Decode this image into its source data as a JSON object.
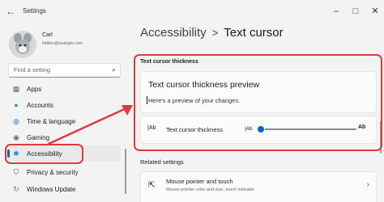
{
  "window": {
    "title": "Settings",
    "back_icon": "arrow-left-icon",
    "controls": {
      "minimize": "–",
      "maximize": "□",
      "close": "✕"
    }
  },
  "user": {
    "name": "Carl",
    "email": "hidden@example.com"
  },
  "search": {
    "placeholder": "Find a setting",
    "icon": "search-icon"
  },
  "nav": {
    "items": [
      {
        "label": "Apps",
        "icon": "apps-icon",
        "glyph": "▦",
        "color": "#5a6b85"
      },
      {
        "label": "Accounts",
        "icon": "accounts-icon",
        "glyph": "●",
        "color": "#2aa876"
      },
      {
        "label": "Time & language",
        "icon": "globe-icon",
        "glyph": "◍",
        "color": "#2b7fd8"
      },
      {
        "label": "Gaming",
        "icon": "gaming-icon",
        "glyph": "◉",
        "color": "#6b6b6b"
      },
      {
        "label": "Accessibility",
        "icon": "accessibility-icon",
        "glyph": "✱",
        "color": "#2b7fd8",
        "active": true
      },
      {
        "label": "Privacy & security",
        "icon": "shield-icon",
        "glyph": "⛉",
        "color": "#555"
      },
      {
        "label": "Windows Update",
        "icon": "update-icon",
        "glyph": "↻",
        "color": "#2b7fd8"
      }
    ]
  },
  "breadcrumb": {
    "parent": "Accessibility",
    "separator": ">",
    "current": "Text cursor"
  },
  "thickness_section": {
    "title": "Text cursor thickness",
    "preview_title": "Text cursor thickness preview",
    "preview_text": "Here's a preview of your changes.",
    "row_icon_text": "|Ab",
    "row_label": "Text cursor thickness",
    "slider_low": "|Ab",
    "slider_high": "Ab",
    "slider_value": 0.03
  },
  "related": {
    "title": "Related settings",
    "items": [
      {
        "title": "Mouse pointer and touch",
        "description": "Mouse pointer color and size, touch indicator",
        "icon": "mouse-pointer-icon",
        "glyph": "⇱",
        "chevron": "›"
      }
    ]
  },
  "colors": {
    "accent": "#0067c0",
    "annotation": "#e03a3a"
  }
}
